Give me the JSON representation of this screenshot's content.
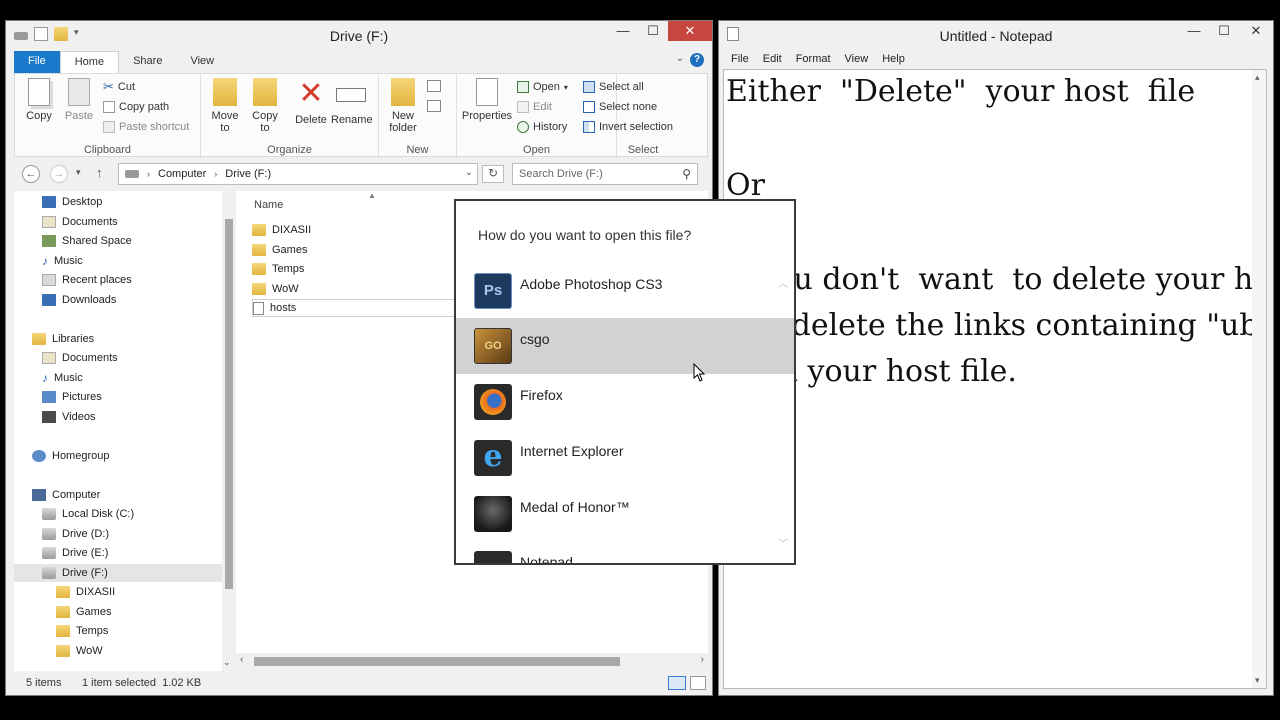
{
  "explorer": {
    "title": "Drive (F:)",
    "ribbon_tabs": [
      "File",
      "Home",
      "Share",
      "View"
    ],
    "clipboard": {
      "copy": "Copy",
      "paste": "Paste",
      "cut": "Cut",
      "copy_path": "Copy path",
      "paste_shortcut": "Paste shortcut",
      "label": "Clipboard"
    },
    "organize": {
      "move_to": "Move\nto",
      "copy_to": "Copy\nto",
      "delete": "Delete",
      "rename": "Rename",
      "label": "Organize"
    },
    "new": {
      "new_folder": "New\nfolder",
      "label": "New"
    },
    "open": {
      "properties": "Properties",
      "open": "Open",
      "edit": "Edit",
      "history": "History",
      "label": "Open"
    },
    "select": {
      "select_all": "Select all",
      "select_none": "Select none",
      "invert": "Invert selection",
      "label": "Select"
    },
    "breadcrumb": [
      "Computer",
      "Drive (F:)"
    ],
    "search_placeholder": "Search Drive (F:)",
    "nav": {
      "favorites": [
        "Desktop",
        "Documents",
        "Shared Space",
        "Music",
        "Recent places",
        "Downloads"
      ],
      "libraries_label": "Libraries",
      "libraries": [
        "Documents",
        "Music",
        "Pictures",
        "Videos"
      ],
      "homegroup": "Homegroup",
      "computer_label": "Computer",
      "drives": [
        "Local Disk (C:)",
        "Drive (D:)",
        "Drive (E:)",
        "Drive (F:)"
      ],
      "subfolders": [
        "DIXASII",
        "Games",
        "Temps",
        "WoW"
      ]
    },
    "column_name": "Name",
    "files": [
      "DIXASII",
      "Games",
      "Temps",
      "WoW",
      "hosts"
    ],
    "status": {
      "items": "5 items",
      "selected": "1 item selected  1.02 KB"
    }
  },
  "notepad": {
    "title": "Untitled - Notepad",
    "menu": [
      "File",
      "Edit",
      "Format",
      "View",
      "Help"
    ],
    "lines": [
      "Either  \"Delete\"  your host  file",
      "Or",
      "If you don't  want  to delete your host file",
      "just delete the links containing \"ubi\"",
      "from your host file."
    ]
  },
  "open_with": {
    "question": "How do you want to open this file?",
    "apps": [
      {
        "name": "Adobe Photoshop CS3",
        "icon": "photoshop-icon"
      },
      {
        "name": "csgo",
        "icon": "csgo-icon"
      },
      {
        "name": "Firefox",
        "icon": "firefox-icon"
      },
      {
        "name": "Internet Explorer",
        "icon": "internet-explorer-icon"
      },
      {
        "name": "Medal of Honor™",
        "icon": "medal-of-honor-icon"
      },
      {
        "name": "Notepad",
        "icon": "notepad-icon"
      }
    ]
  },
  "colors": {
    "file_tab": "#1979ca",
    "close_button": "#c7463f",
    "hover_row": "#d2d2d2",
    "photoshop": "#1e3a5f"
  }
}
